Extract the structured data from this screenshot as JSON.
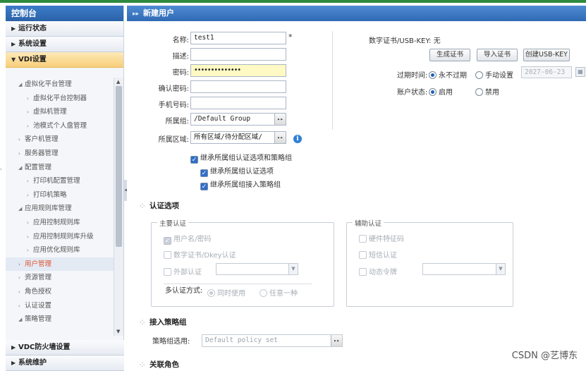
{
  "sidebar": {
    "title": "控制台",
    "top_sections": [
      {
        "label": "运行状态",
        "open": false
      },
      {
        "label": "系统设置",
        "open": false
      },
      {
        "label": "VDI设置",
        "open": true
      }
    ],
    "tree": [
      {
        "label": "虚拟化平台管理",
        "level": 1,
        "icon": "triangle-down-icon",
        "active": false
      },
      {
        "label": "虚拟化平台控制器",
        "level": 2,
        "icon": "chevron-right-icon",
        "active": false
      },
      {
        "label": "虚拟机管理",
        "level": 2,
        "icon": "chevron-right-icon",
        "active": false
      },
      {
        "label": "池模式个人盘管理",
        "level": 2,
        "icon": "chevron-right-icon",
        "active": false
      },
      {
        "label": "客户机管理",
        "level": 1,
        "icon": "chevron-right-icon",
        "active": false
      },
      {
        "label": "服务器管理",
        "level": 1,
        "icon": "chevron-right-icon",
        "active": false
      },
      {
        "label": "配置管理",
        "level": 1,
        "icon": "triangle-down-icon",
        "active": false
      },
      {
        "label": "打印机配置管理",
        "level": 2,
        "icon": "chevron-right-icon",
        "active": false
      },
      {
        "label": "打印机策略",
        "level": 2,
        "icon": "chevron-right-icon",
        "active": false
      },
      {
        "label": "应用规则库管理",
        "level": 1,
        "icon": "triangle-down-icon",
        "active": false
      },
      {
        "label": "应用控制规则库",
        "level": 2,
        "icon": "chevron-right-icon",
        "active": false
      },
      {
        "label": "应用控制规则库升级",
        "level": 2,
        "icon": "chevron-right-icon",
        "active": false
      },
      {
        "label": "应用优化规则库",
        "level": 2,
        "icon": "chevron-right-icon",
        "active": false
      },
      {
        "label": "用户管理",
        "level": 1,
        "icon": "chevron-right-icon",
        "active": true
      },
      {
        "label": "资源管理",
        "level": 1,
        "icon": "chevron-right-icon",
        "active": false
      },
      {
        "label": "角色授权",
        "level": 1,
        "icon": "chevron-right-icon",
        "active": false
      },
      {
        "label": "认证设置",
        "level": 1,
        "icon": "chevron-right-icon",
        "active": false
      },
      {
        "label": "策略管理",
        "level": 1,
        "icon": "triangle-down-icon",
        "active": false
      }
    ],
    "bottom_sections": [
      {
        "label": "VDC防火墙设置"
      },
      {
        "label": "系统维护"
      }
    ]
  },
  "main": {
    "header_title": "新建用户",
    "form": {
      "name_label": "名称:",
      "name_value": "test1",
      "required_mark": "*",
      "desc_label": "描述:",
      "desc_value": "",
      "password_label": "密码:",
      "password_value": "••••••••••••••",
      "confirm_label": "确认密码:",
      "confirm_value": "",
      "phone_label": "手机号码:",
      "phone_value": "",
      "group_label": "所属组:",
      "group_value": "/Default Group",
      "area_label": "所属区域:",
      "area_value": "所有区域/待分配区域/",
      "inherit_all": "继承所属组认证选项和策略组",
      "inherit_auth": "继承所属组认证选项",
      "inherit_policy": "继承所属组接入策略组"
    },
    "right": {
      "cert_label": "数字证书/USB-KEY: 无",
      "btn_generate": "生成证书",
      "btn_import": "导入证书",
      "btn_create_usbkey": "创建USB-KEY",
      "expire_label": "过期时间:",
      "expire_never": "永不过期",
      "expire_manual": "手动设置",
      "expire_date": "2027-06-23",
      "status_label": "账户状态:",
      "status_enabled": "启用",
      "status_disabled": "禁用"
    },
    "auth_section": {
      "title": "认证选项",
      "primary_legend": "主要认证",
      "primary_items": [
        "用户名/密码",
        "数字证书/Dkey认证",
        "外部认证"
      ],
      "multi_label": "多认证方式:",
      "multi_opt1": "同时使用",
      "multi_opt2": "任意一种",
      "secondary_legend": "辅助认证",
      "secondary_items": [
        "硬件特征码",
        "短信认证",
        "动态令牌"
      ]
    },
    "policy_section": {
      "title": "接入策略组",
      "select_label": "策略组选用:",
      "select_value": "Default policy set"
    },
    "next_section_title": "关联角色"
  },
  "watermark": "CSDN @艺博东"
}
